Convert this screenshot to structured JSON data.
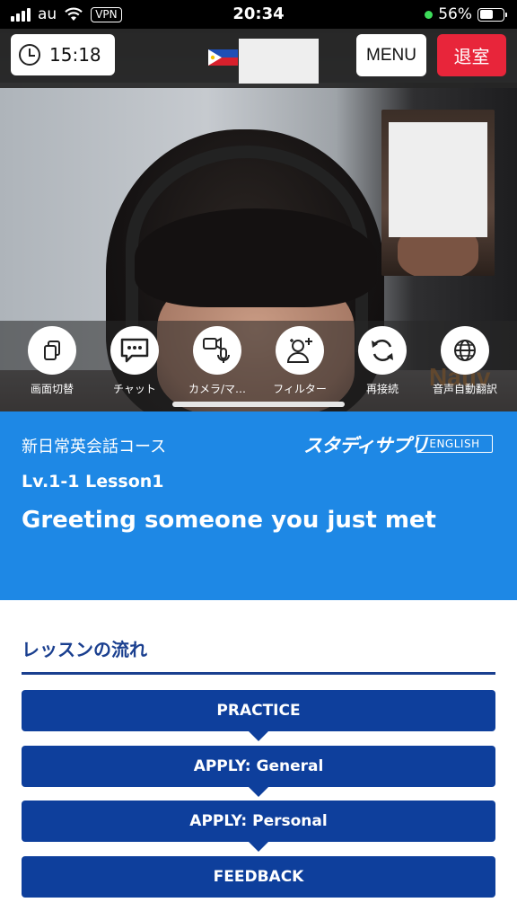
{
  "status_bar": {
    "carrier": "au",
    "vpn": "VPN",
    "time": "20:34",
    "battery": "56%",
    "battery_level": 0.56
  },
  "call": {
    "timer": "15:18",
    "menu_label": "MENU",
    "exit_label": "退室"
  },
  "controls": [
    {
      "label": "画面切替",
      "icon": "switch-screen-icon"
    },
    {
      "label": "チャット",
      "icon": "chat-icon"
    },
    {
      "label": "カメラ/マ…",
      "icon": "camera-mic-icon"
    },
    {
      "label": "フィルター",
      "icon": "add-person-icon"
    },
    {
      "label": "再接続",
      "icon": "reconnect-icon"
    },
    {
      "label": "音声自動翻訳",
      "icon": "globe-icon"
    }
  ],
  "lesson": {
    "course": "新日常英会話コース",
    "brand": "スタディサプリ",
    "language": "ENGLISH",
    "level": "Lv.1-1 Lesson1",
    "title": "Greeting someone you just met"
  },
  "flow": {
    "heading": "レッスンの流れ",
    "steps": [
      "PRACTICE",
      "APPLY: General",
      "APPLY: Personal",
      "FEEDBACK"
    ]
  },
  "colors": {
    "lesson_blue": "#1e88e5",
    "step_navy": "#0e3f9c",
    "exit_red": "#e8253a"
  }
}
